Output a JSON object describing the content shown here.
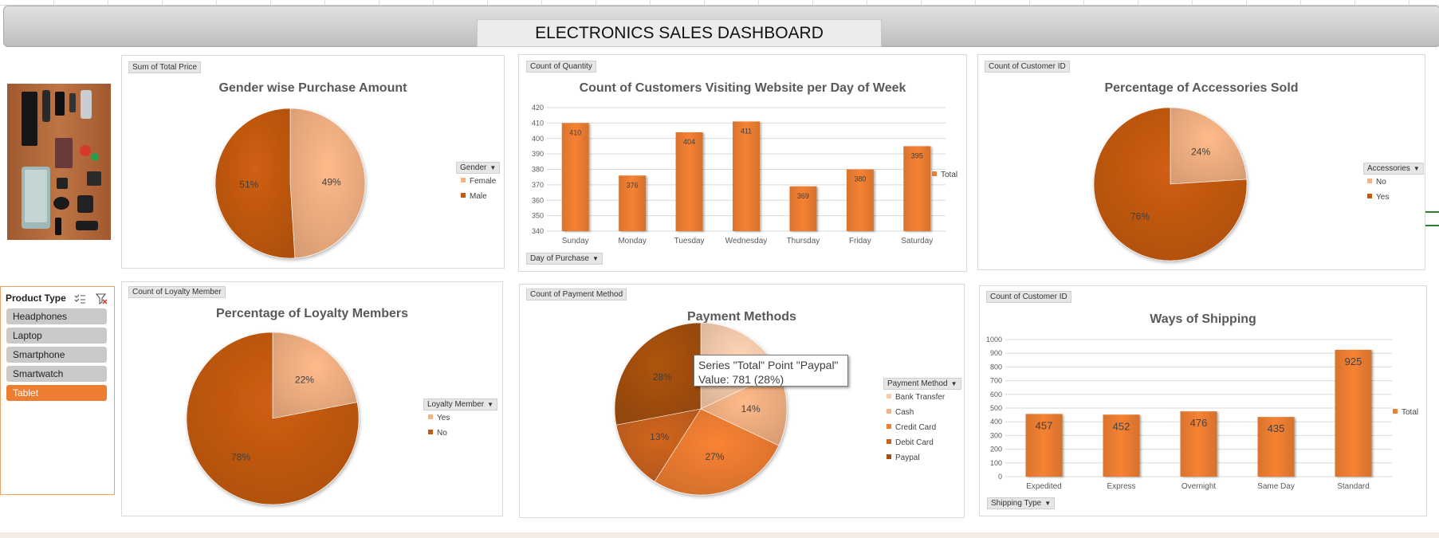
{
  "dashboard": {
    "title": "ELECTRONICS SALES DASHBOARD",
    "colors": {
      "accent": "#ed7d31",
      "banner": "#c8c8c8",
      "selected": "#ed7d31"
    }
  },
  "slicer": {
    "title": "Product Type",
    "icons": [
      "multi-select-icon",
      "clear-filter-icon"
    ],
    "items": [
      "Headphones",
      "Laptop",
      "Smartphone",
      "Smartwatch",
      "Tablet"
    ],
    "selected": "Tablet"
  },
  "tooltip": {
    "line1": "Series \"Total\" Point \"Paypal\"",
    "line2": "Value: 781 (28%)"
  },
  "chart_data": [
    {
      "id": "gender",
      "type": "pie",
      "title": "Gender wise Purchase Amount",
      "field_button": "Sum of Total Price",
      "legend_title": "Gender",
      "legend_placement": "right",
      "categories": [
        "Female",
        "Male"
      ],
      "values": [
        49,
        51
      ],
      "labels": [
        "49%",
        "51%"
      ],
      "colors": [
        "#f4b183",
        "#c55a11"
      ]
    },
    {
      "id": "dayofweek",
      "type": "bar",
      "title": "Count of Customers Visiting Website per Day of Week",
      "field_button": "Count of Quantity",
      "axis_button": "Day of Purchase",
      "legend": "Total",
      "legend_placement": "right",
      "categories": [
        "Sunday",
        "Monday",
        "Tuesday",
        "Wednesday",
        "Thursday",
        "Friday",
        "Saturday"
      ],
      "values": [
        410,
        376,
        404,
        411,
        369,
        380,
        395
      ],
      "ylim": [
        340,
        420
      ],
      "yticks": [
        340,
        350,
        360,
        370,
        380,
        390,
        400,
        410,
        420
      ],
      "grid": true,
      "color": "#ed7d31"
    },
    {
      "id": "accessories",
      "type": "pie",
      "title": "Percentage of Accessories Sold",
      "field_button": "Count of Customer ID",
      "legend_title": "Accessories",
      "legend_placement": "right",
      "categories": [
        "No",
        "Yes"
      ],
      "values": [
        24,
        76
      ],
      "labels": [
        "24%",
        "76%"
      ],
      "colors": [
        "#f4b183",
        "#c55a11"
      ]
    },
    {
      "id": "loyalty",
      "type": "pie",
      "title": "Percentage of Loyalty Members",
      "field_button": "Count of Loyalty Member",
      "legend_title": "Loyalty Member",
      "legend_placement": "right",
      "categories": [
        "Yes",
        "No"
      ],
      "values": [
        22,
        78
      ],
      "labels": [
        "22%",
        "78%"
      ],
      "colors": [
        "#f4b183",
        "#c55a11"
      ]
    },
    {
      "id": "payment",
      "type": "pie",
      "title": "Payment Methods",
      "field_button": "Count of Payment Method",
      "legend_title": "Payment Method",
      "legend_placement": "right",
      "categories": [
        "Bank Transfer",
        "Cash",
        "Credit Card",
        "Debit Card",
        "Paypal"
      ],
      "values": [
        18,
        14,
        27,
        13,
        28
      ],
      "labels": [
        "",
        "14%",
        "27%",
        "13%",
        "28%"
      ],
      "colors": [
        "#f8cbad",
        "#f4b183",
        "#ed7d31",
        "#c8611e",
        "#a5500f"
      ]
    },
    {
      "id": "shipping",
      "type": "bar",
      "title": "Ways of Shipping",
      "field_button": "Count of Customer ID",
      "axis_button": "Shipping Type",
      "legend": "Total",
      "legend_placement": "right",
      "categories": [
        "Expedited",
        "Express",
        "Overnight",
        "Same Day",
        "Standard"
      ],
      "values": [
        457,
        452,
        476,
        435,
        925
      ],
      "ylim": [
        0,
        1000
      ],
      "yticks": [
        0,
        100,
        200,
        300,
        400,
        500,
        600,
        700,
        800,
        900,
        1000
      ],
      "grid": true,
      "color": "#ed7d31"
    }
  ]
}
